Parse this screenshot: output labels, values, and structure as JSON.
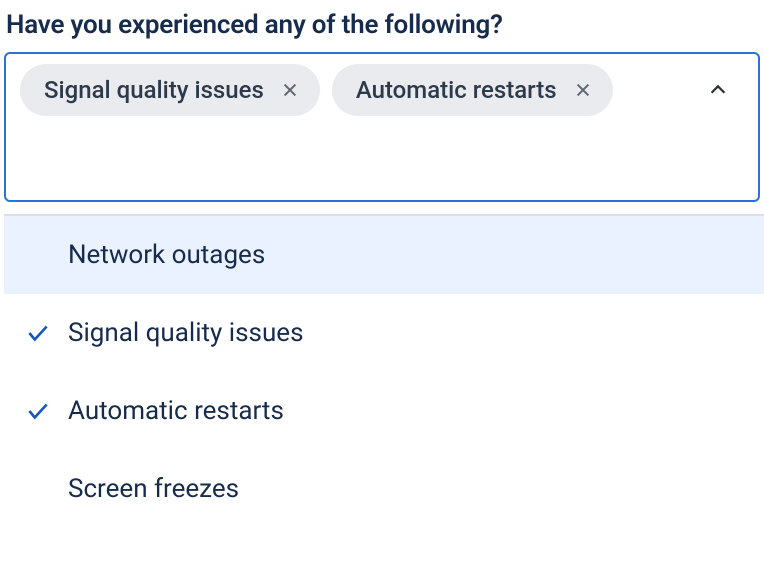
{
  "question": "Have you experienced any of the following?",
  "selected": [
    {
      "label": "Signal quality issues"
    },
    {
      "label": "Automatic restarts"
    }
  ],
  "options": [
    {
      "label": "Network outages",
      "selected": false,
      "active": true
    },
    {
      "label": "Signal quality issues",
      "selected": true,
      "active": false
    },
    {
      "label": "Automatic restarts",
      "selected": true,
      "active": false
    },
    {
      "label": "Screen freezes",
      "selected": false,
      "active": false
    }
  ]
}
